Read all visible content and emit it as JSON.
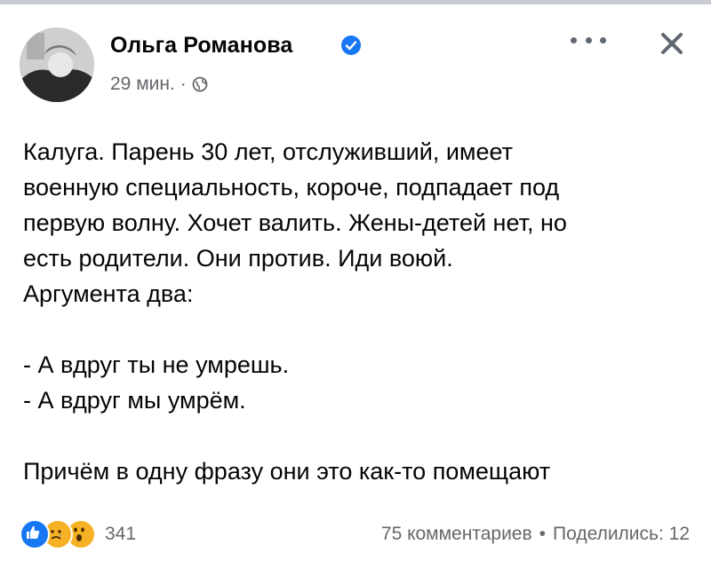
{
  "post": {
    "author": "Ольга Романова",
    "time": "29 мин.",
    "separator": "·",
    "lines": [
      "Калуга. Парень 30 лет, отслуживший, имеет",
      "военную специальность, короче, подпадает под",
      "первую волну. Хочет валить. Жены-детей нет, но",
      "есть родители. Они против. Иди воюй.",
      "Аргумента два:",
      "",
      "- А вдруг ты не умрешь.",
      "- А вдруг мы умрём.",
      "",
      "Причём в одну фразу они это как-то помещают"
    ],
    "reactions": {
      "icons": [
        "like-icon",
        "sad-icon",
        "wow-icon"
      ],
      "count": "341"
    },
    "comments": "75 комментариев",
    "shares": "Поделились: 12",
    "stats_separator": "•"
  },
  "colors": {
    "text": "#050505",
    "secondary": "#65676b",
    "brand": "#1877f2"
  }
}
